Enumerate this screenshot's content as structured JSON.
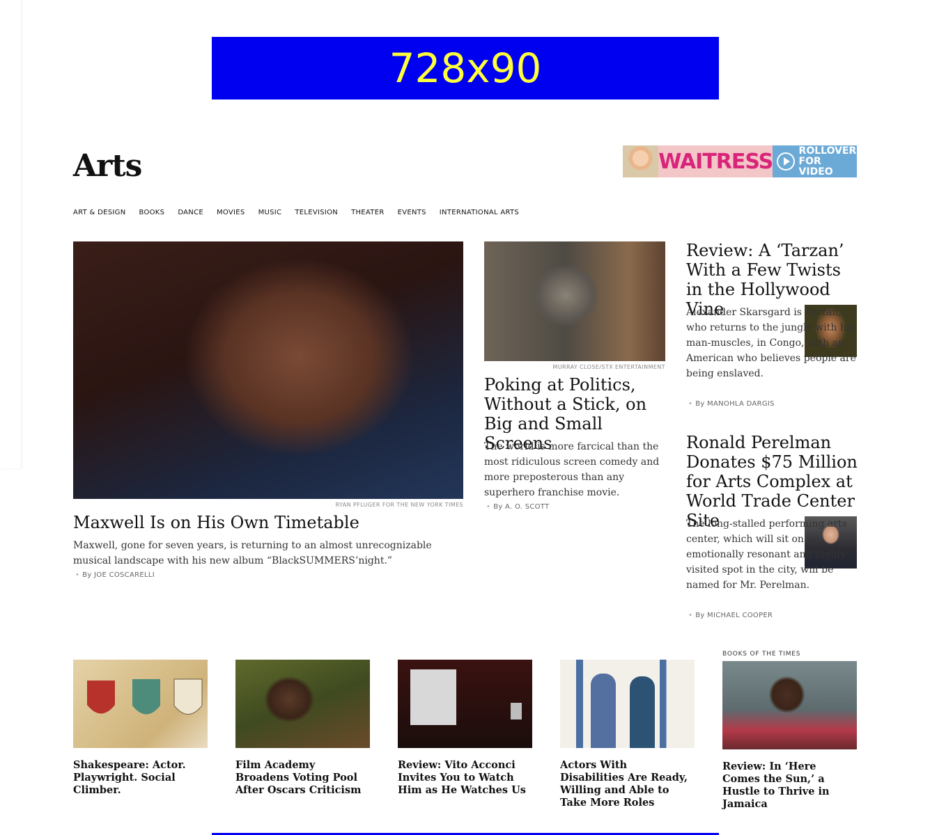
{
  "ads": {
    "top_label": "728x90"
  },
  "section": {
    "title": "Arts"
  },
  "promo": {
    "word": "WAITRESS",
    "cta_line1": "ROLLOVER",
    "cta_line2": "FOR VIDEO"
  },
  "nav": [
    "ART & DESIGN",
    "BOOKS",
    "DANCE",
    "MOVIES",
    "MUSIC",
    "TELEVISION",
    "THEATER",
    "EVENTS",
    "INTERNATIONAL ARTS"
  ],
  "lead": {
    "credit": "RYAN PFLUGER FOR THE NEW YORK TIMES",
    "headline": "Maxwell Is on His Own Timetable",
    "summary": "Maxwell, gone for seven years, is returning to an almost unrecognizable musical landscape with his new album “BlackSUMMERS’night.”",
    "byline": "By JOE COSCARELLI"
  },
  "second": {
    "credit": "MURRAY CLOSE/STX ENTERTAINMENT",
    "headline": "Poking at Politics, Without a Stick, on Big and Small Screens",
    "summary": "The world is more farcical than the most ridiculous screen comedy and more preposterous than any superhero franchise movie.",
    "byline": "By A. O. SCOTT"
  },
  "right_stories": [
    {
      "headline": "Review: A ‘Tarzan’ With a Few Twists in the Hollywood Vine",
      "summary": "Alexander Skarsgard is Tarzan, who returns to the jungle with his man-muscles, in Congo, with an American who believes people are being enslaved.",
      "byline": "By MANOHLA DARGIS"
    },
    {
      "headline": "Ronald Perelman Donates $75 Million for Arts Complex at World Trade Center Site",
      "summary": "The long-stalled performing arts center, which will sit on an emotionally resonant and highly visited spot in the city, will be named for Mr. Perelman.",
      "byline": "By MICHAEL COOPER"
    }
  ],
  "bottom_row": [
    {
      "kicker": "",
      "headline": "Shakespeare: Actor. Playwright. Social Climber."
    },
    {
      "kicker": "",
      "headline": "Film Academy Broadens Voting Pool After Oscars Criticism"
    },
    {
      "kicker": "",
      "headline": "Review: Vito Acconci Invites You to Watch Him as He Watches Us"
    },
    {
      "kicker": "",
      "headline": "Actors With Disabilities Are Ready, Willing and Able to Take More Roles"
    },
    {
      "kicker": "BOOKS OF THE TIMES",
      "headline": "Review: In ‘Here Comes the Sun,’ a Hustle to Thrive in Jamaica"
    }
  ]
}
